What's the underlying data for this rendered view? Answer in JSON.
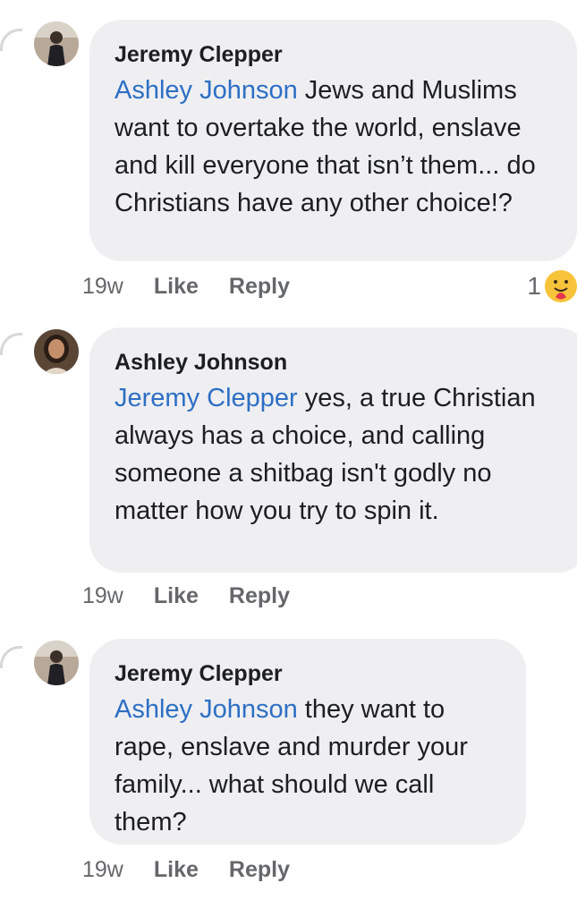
{
  "comments": [
    {
      "author": "Jeremy Clepper",
      "mention": "Ashley Johnson",
      "text": " Jews and Muslims want to overtake the world, enslave and kill everyone that isn’t them... do Christians have any other choice!?",
      "time": "19w",
      "like": "Like",
      "reply": "Reply",
      "reaction_count": "1",
      "reaction_icon": "care-reaction-icon"
    },
    {
      "author": "Ashley Johnson",
      "mention": "Jeremy Clepper",
      "text": " yes, a true Christian always has a choice, and calling someone a shitbag isn't godly no matter how you try to spin it.",
      "time": "19w",
      "like": "Like",
      "reply": "Reply"
    },
    {
      "author": "Jeremy Clepper",
      "mention": "Ashley Johnson",
      "text": " they want to rape, enslave and murder your family... what should we call them?",
      "time": "19w",
      "like": "Like",
      "reply": "Reply"
    }
  ],
  "colors": {
    "bubble": "#efeff2",
    "mention": "#2d6fc4",
    "meta": "#65676b"
  }
}
